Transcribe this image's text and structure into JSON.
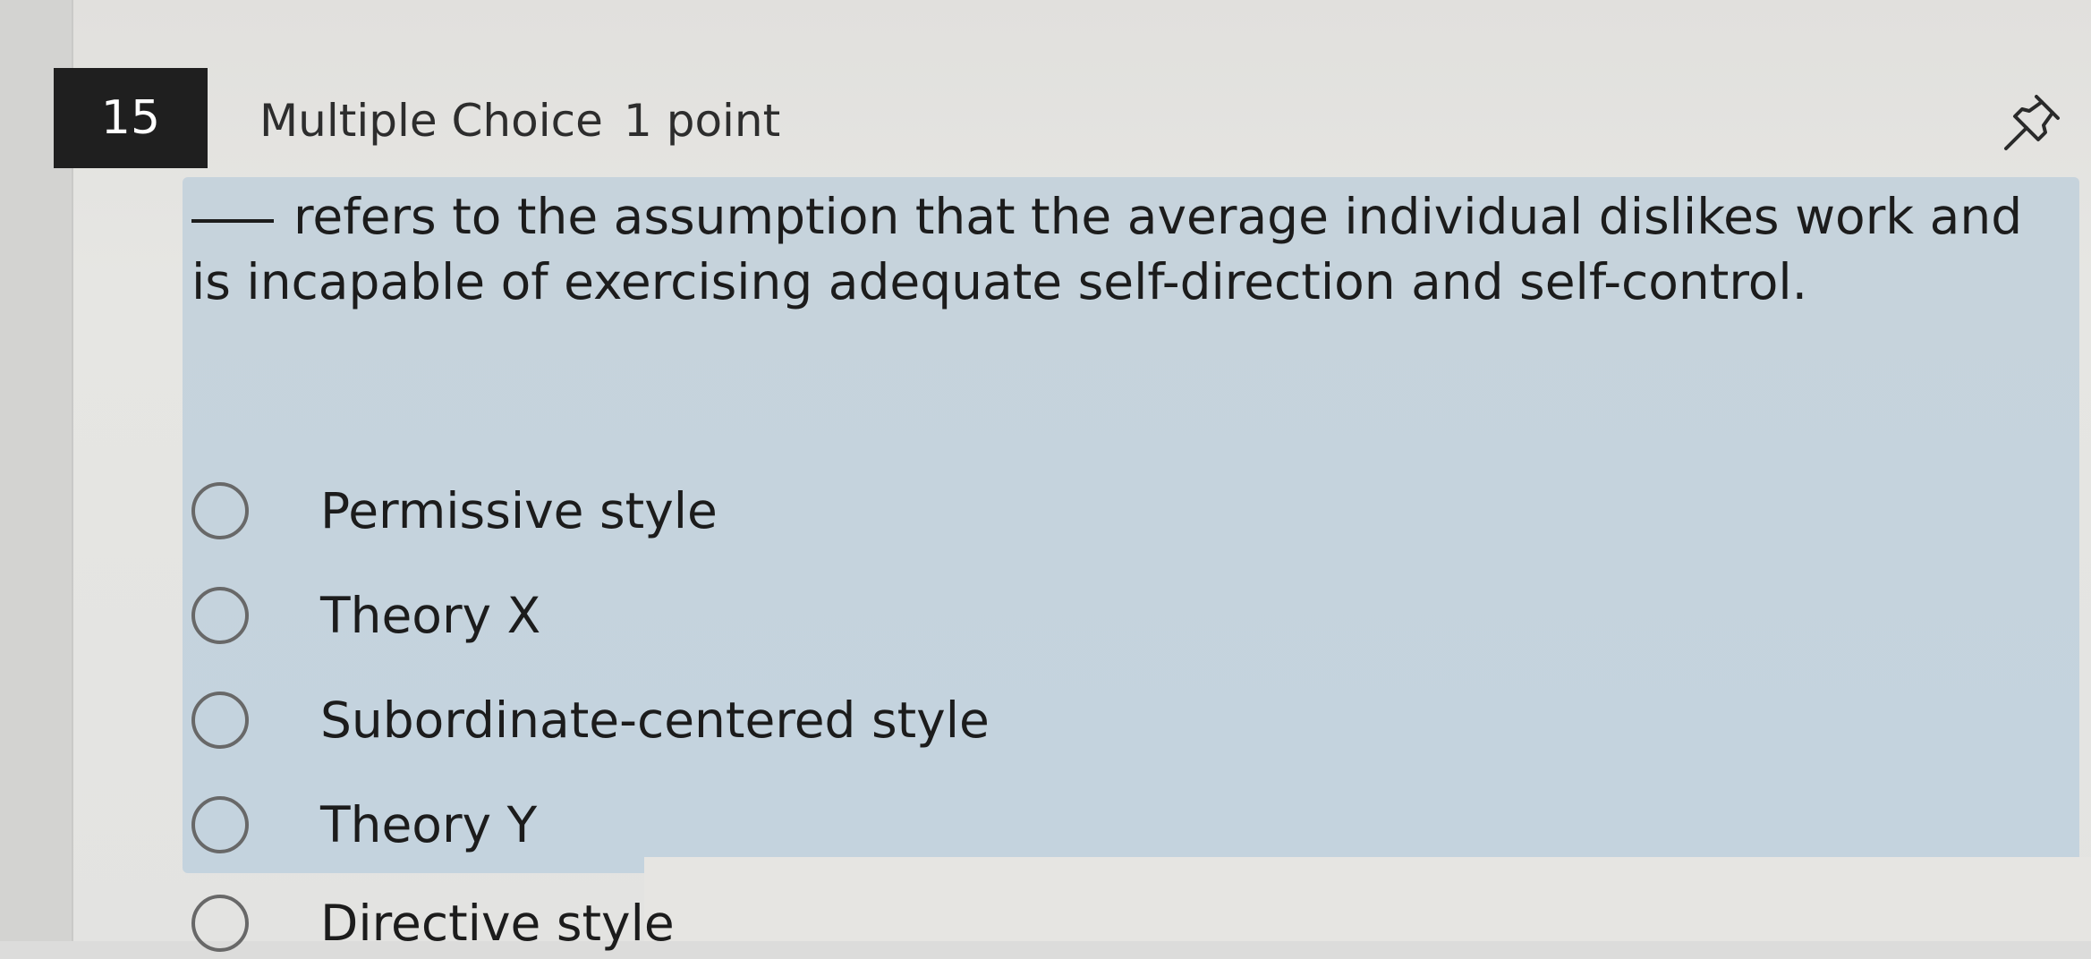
{
  "question": {
    "number": "15",
    "type": "Multiple Choice",
    "points": "1 point",
    "text": "refers to the assumption that the average individual dislikes work and is incapable of exercising adequate self-direction and self-control.",
    "pin_icon": "pin-icon"
  },
  "choices": [
    {
      "label": "Permissive style",
      "selected": false
    },
    {
      "label": "Theory X",
      "selected": false
    },
    {
      "label": "Subordinate-centered style",
      "selected": false
    },
    {
      "label": "Theory Y",
      "selected": false
    },
    {
      "label": "Directive style",
      "selected": false
    }
  ],
  "colors": {
    "number_badge_bg": "#1f1f1f",
    "number_badge_text": "#ffffff",
    "highlight_panel": "#c6d3dc",
    "page_bg": "#e3e3e1"
  }
}
